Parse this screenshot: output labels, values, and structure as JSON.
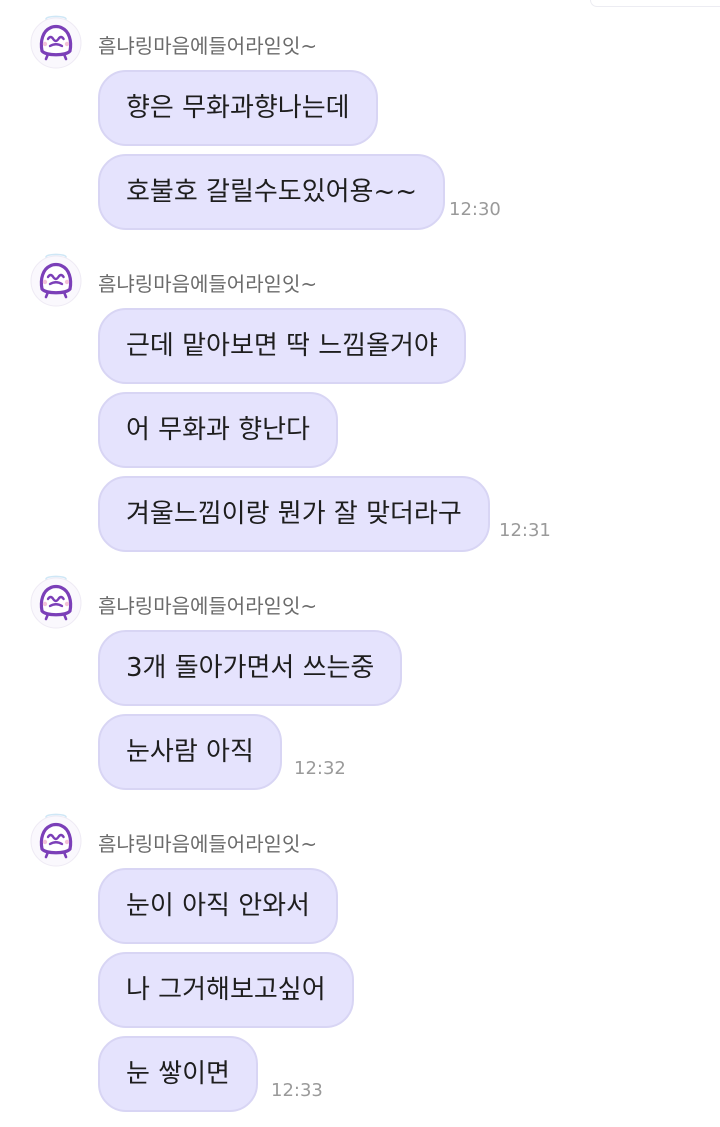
{
  "groups": [
    {
      "sender": "흠냐링마음에들어라읻잇~",
      "messages": [
        "향은 무화과향나는데",
        "호불호 갈릴수도있어용~~"
      ],
      "time": "12:30"
    },
    {
      "sender": "흠냐링마음에들어라읻잇~",
      "messages": [
        "근데 맡아보면 딱 느낌올거야",
        "어 무화과 향난다",
        "겨울느낌이랑 뭔가 잘 맞더라구"
      ],
      "time": "12:31"
    },
    {
      "sender": "흠냐링마음에들어라읻잇~",
      "messages": [
        "3개 돌아가면서 쓰는중",
        "눈사람 아직"
      ],
      "time": "12:32"
    },
    {
      "sender": "흠냐링마음에들어라읻잇~",
      "messages": [
        "눈이 아직 안와서",
        "나 그거해보고싶어",
        "눈 쌓이면"
      ],
      "time": "12:33"
    }
  ],
  "icons": {
    "avatar": "cartoon-face-avatar-icon"
  },
  "colors": {
    "bubble_bg": "#e5e3fd",
    "bubble_border": "#d8d5f4",
    "avatar_outline": "#7b3fb8",
    "sender_text": "#6b6b6b",
    "time_text": "#9a9a9a"
  }
}
